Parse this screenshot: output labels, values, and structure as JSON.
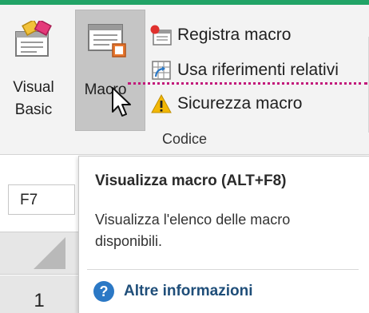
{
  "ribbon": {
    "visual_basic": {
      "line1": "Visual",
      "line2": "Basic",
      "icon": "visual-basic-icon"
    },
    "macro": {
      "label": "Macro",
      "icon": "macro-icon",
      "state": "hover"
    },
    "small_buttons": [
      {
        "label": "Registra macro",
        "icon": "record-macro-icon"
      },
      {
        "label": "Usa riferimenti relativi",
        "icon": "relative-references-icon"
      },
      {
        "label": "Sicurezza macro",
        "icon": "warning-icon"
      }
    ],
    "group_label": "Codice"
  },
  "sheet": {
    "namebox_value": "F7",
    "row_header": "1"
  },
  "tooltip": {
    "title": "Visualizza macro (ALT+F8)",
    "description": "Visualizza l'elenco delle macro disponibili.",
    "more_info": "Altre informazioni",
    "help_icon_glyph": "?"
  },
  "colors": {
    "accent_green": "#21a366",
    "dotted_marker": "#c2187a",
    "help_blue": "#2b78c5",
    "hover_gray": "#c5c5c5"
  }
}
